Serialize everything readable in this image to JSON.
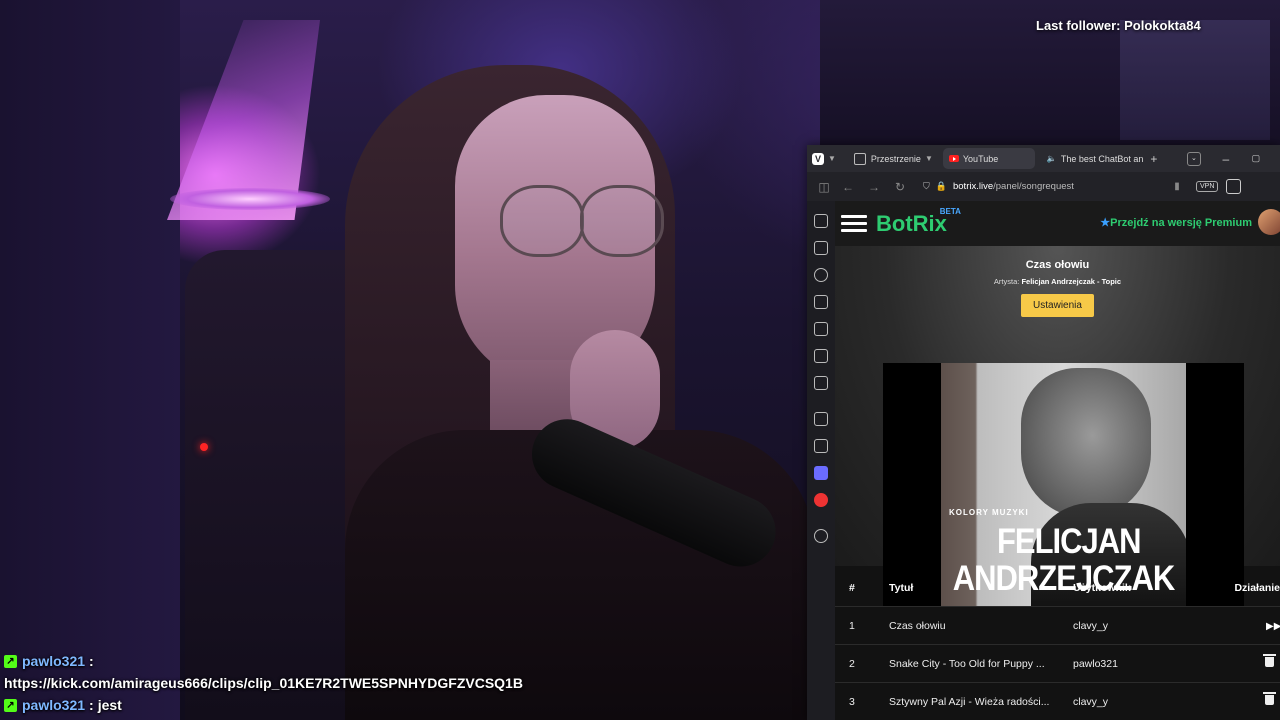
{
  "overlay": {
    "last_follower": "Last follower: Polokokta84"
  },
  "chat": [
    {
      "user": "pawlo321",
      "separator": ":",
      "message": ""
    },
    {
      "user": "",
      "separator": "",
      "message": "https://kick.com/amirageus666/clips/clip_01KE7R2TWE5SPNHYDGFZVCSQ1B"
    },
    {
      "user": "pawlo321",
      "separator": ":",
      "message": "jest"
    }
  ],
  "browser": {
    "spaces_label": "Przestrzenie",
    "tabs": [
      {
        "label": "YouTube",
        "icon": "youtube-icon",
        "active": true
      },
      {
        "label": "The best ChatBot an",
        "icon": "speaker-icon",
        "active": false
      }
    ],
    "url_host": "botrix.live",
    "url_path": "/panel/songrequest",
    "vpn_label": "VPN"
  },
  "botrix": {
    "brand": "BotRix",
    "beta": "BETA",
    "premium_label": "Przejdź na wersję Premium",
    "song_title": "Czas ołowiu",
    "artist_label": "Artysta:",
    "artist_name": "Felicjan Andrzejczak - Topic",
    "settings_button": "Ustawienia",
    "cover": {
      "series": "KOLORY MUZYKI",
      "name_line1": "FELICJAN",
      "name_line2": "ANDRZEJCZAK"
    },
    "queue_headers": {
      "num": "#",
      "title": "Tytuł",
      "user": "Użytkownik",
      "action": "Działanie"
    },
    "queue": [
      {
        "num": "1",
        "title": "Czas ołowiu",
        "user": "clavy_y",
        "action": "play-next-icon"
      },
      {
        "num": "2",
        "title": "Snake City - Too Old for Puppy ...",
        "user": "pawlo321",
        "action": "trash-icon"
      },
      {
        "num": "3",
        "title": "Sztywny Pal Azji - Wieża radości...",
        "user": "clavy_y",
        "action": "trash-icon"
      }
    ]
  },
  "colors": {
    "brand_green": "#2ecc71",
    "settings_yellow": "#f7c948",
    "kick_green": "#53fc18",
    "chat_user": "#7fb8ff"
  }
}
